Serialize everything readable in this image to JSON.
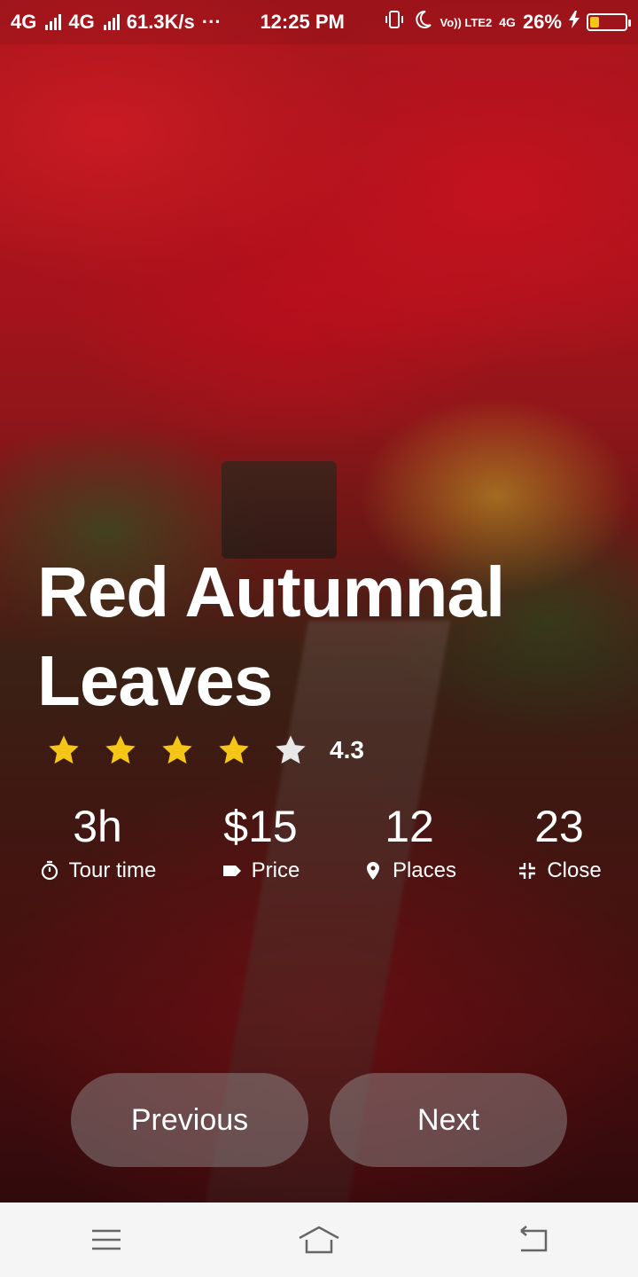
{
  "status_bar": {
    "network1": "4G",
    "network2": "4G",
    "speed": "61.3K/s",
    "more": "···",
    "time": "12:25 PM",
    "volte": "Vo)) LTE2",
    "network3": "4G",
    "battery": "26%",
    "battery_level": 0.26
  },
  "tour": {
    "title": "Red Autumnal Leaves",
    "rating": "4.3",
    "rating_value": 4.3,
    "stars_filled": 4,
    "stars_total": 5,
    "stats": [
      {
        "value": "3h",
        "label": "Tour time",
        "icon": "timer-icon"
      },
      {
        "value": "$15",
        "label": "Price",
        "icon": "tag-icon"
      },
      {
        "value": "12",
        "label": "Places",
        "icon": "location-pin-icon"
      },
      {
        "value": "23",
        "label": "Close",
        "icon": "collapse-icon"
      }
    ]
  },
  "buttons": {
    "previous": "Previous",
    "next": "Next"
  },
  "nav_bar": {
    "menu_icon": "menu-icon",
    "home_icon": "home-icon",
    "back_icon": "back-icon"
  },
  "colors": {
    "star_filled": "#F5C518",
    "star_empty": "#E8E8E8",
    "button_bg": "rgba(150,150,150,0.45)",
    "nav_bg": "#F5F5F5"
  }
}
